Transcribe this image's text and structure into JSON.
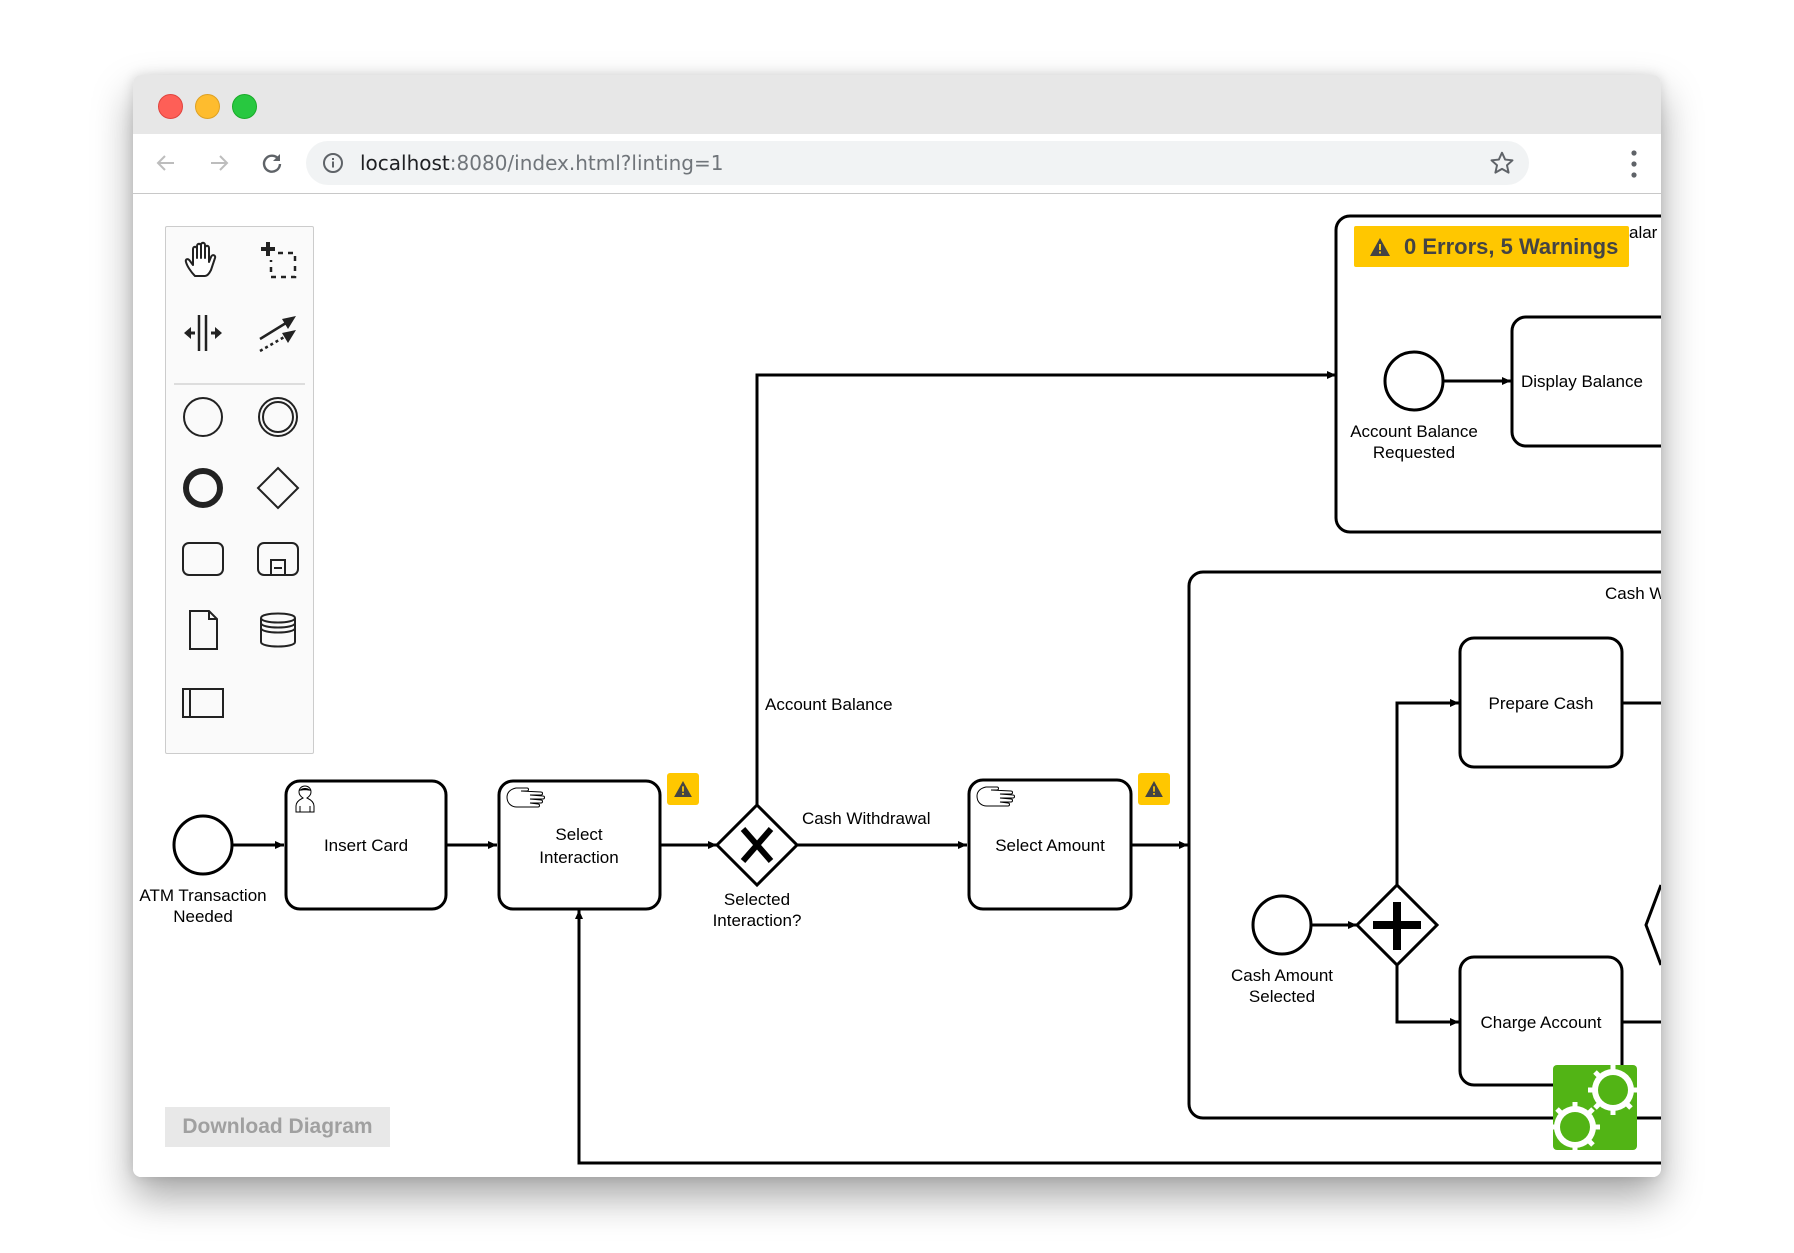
{
  "browser": {
    "traffic_lights": [
      "close",
      "minimize",
      "maximize"
    ],
    "url_host": "localhost",
    "url_rest": ":8080/index.html?linting=1",
    "icons": {
      "back": "arrow-left-icon",
      "forward": "arrow-right-icon",
      "reload": "reload-icon",
      "info": "info-icon",
      "bookmark": "star-icon",
      "menu": "more-vertical-icon"
    }
  },
  "palette": {
    "tools": [
      {
        "name": "hand-tool",
        "icon": "hand-icon"
      },
      {
        "name": "lasso-tool",
        "icon": "lasso-icon"
      },
      {
        "name": "space-tool",
        "icon": "space-tool-icon"
      },
      {
        "name": "global-connect-tool",
        "icon": "connect-icon"
      }
    ],
    "shapes": [
      {
        "name": "start-event",
        "icon": "start-event-icon"
      },
      {
        "name": "intermediate-event",
        "icon": "intermediate-event-icon"
      },
      {
        "name": "end-event",
        "icon": "end-event-icon"
      },
      {
        "name": "gateway",
        "icon": "gateway-icon"
      },
      {
        "name": "task",
        "icon": "task-icon"
      },
      {
        "name": "subprocess",
        "icon": "subprocess-icon"
      },
      {
        "name": "data-object",
        "icon": "data-object-icon"
      },
      {
        "name": "data-store",
        "icon": "data-store-icon"
      },
      {
        "name": "participant",
        "icon": "participant-icon"
      }
    ]
  },
  "linting": {
    "summary": "0 Errors, 5 Warnings",
    "errors": 0,
    "warnings": 5,
    "badge_color": "#ffc700"
  },
  "download_button": "Download Diagram",
  "diagram": {
    "events": {
      "atm_start": [
        "ATM Transaction",
        "Needed"
      ],
      "balance_start": [
        "Account Balance",
        "Requested"
      ],
      "cash_start": [
        "Cash Amount",
        "Selected"
      ]
    },
    "tasks": {
      "insert_card": "Insert Card",
      "select_interaction": [
        "Select",
        "Interaction"
      ],
      "select_amount": "Select Amount",
      "display_balance": "Display Balance",
      "prepare_cash": "Prepare Cash",
      "charge_account": "Charge Account"
    },
    "gateway": {
      "selected_interaction": [
        "Selected",
        "Interaction?"
      ]
    },
    "flows": {
      "account_balance": "Account Balance",
      "cash_withdrawal": "Cash Withdrawal"
    },
    "subprocesses": {
      "account_balance_partial": "alar",
      "cash_withdrawal_partial": "Cash W"
    }
  },
  "logo_color": "#52b415"
}
